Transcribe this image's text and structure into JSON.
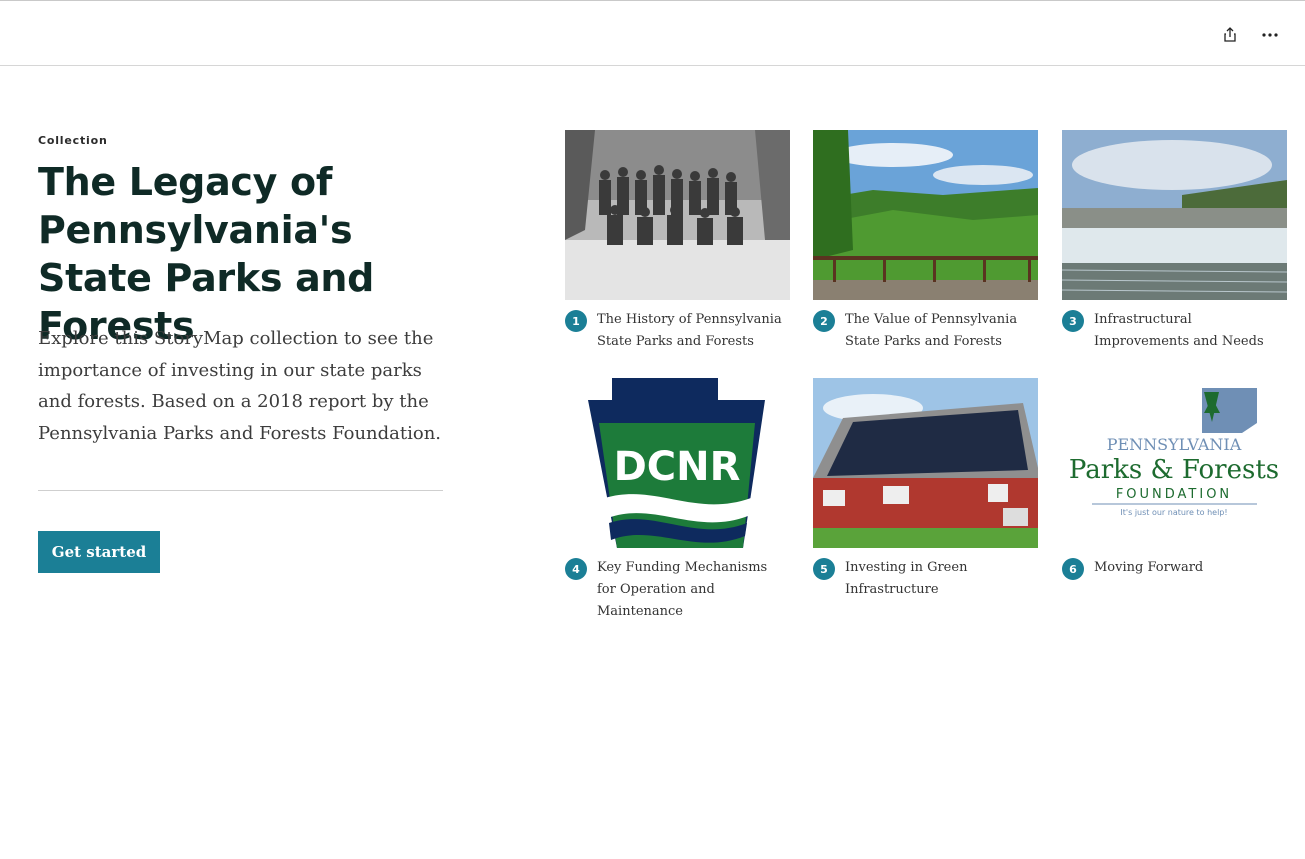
{
  "header": {
    "share_icon": "share-icon",
    "more_icon": "more-options-icon"
  },
  "intro": {
    "kicker": "Collection",
    "title": "The Legacy of Pennsylvania's State Parks and Forests",
    "description": "Explore this StoryMap collection to see the importance of investing in our state parks and forests. Based on a 2018 report by the Pennsylvania Parks and Forests Foundation.",
    "cta_label": "Get started"
  },
  "colors": {
    "accent": "#1b7f96",
    "title": "#0f2a26"
  },
  "items": [
    {
      "number": "1",
      "title": "The History of Pennsylvania State Parks and Forests",
      "thumbnail": "historic-group-photo"
    },
    {
      "number": "2",
      "title": "The Value of Pennsylvania State Parks and Forests",
      "thumbnail": "valley-overlook-photo"
    },
    {
      "number": "3",
      "title": "Infrastructural Improvements and Needs",
      "thumbnail": "dam-spillway-photo"
    },
    {
      "number": "4",
      "title": "Key Funding Mechanisms for Operation and Maintenance",
      "thumbnail": "dcnr-logo"
    },
    {
      "number": "5",
      "title": "Investing in Green Infrastructure",
      "thumbnail": "solar-barn-photo"
    },
    {
      "number": "6",
      "title": "Moving Forward",
      "thumbnail": "foundation-logo"
    }
  ],
  "logos": {
    "dcnr_text": "DCNR",
    "foundation_line1": "PENNSYLVANIA",
    "foundation_line2": "Parks & Forests",
    "foundation_line3": "FOUNDATION",
    "foundation_tagline": "It's just our nature to help!"
  }
}
